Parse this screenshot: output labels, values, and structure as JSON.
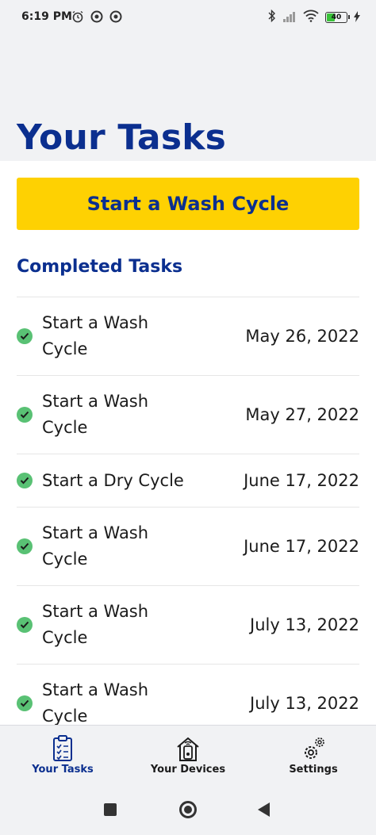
{
  "status_bar": {
    "time": "6:19 PM",
    "battery": "40"
  },
  "header": {
    "title": "Your Tasks"
  },
  "primary_action": {
    "label": "Start a Wash Cycle"
  },
  "completed": {
    "heading": "Completed Tasks",
    "tasks": [
      {
        "name": "Start a Wash Cycle",
        "date": "May 26, 2022"
      },
      {
        "name": "Start a Wash Cycle",
        "date": "May 27, 2022"
      },
      {
        "name": "Start a Dry Cycle",
        "date": "June 17, 2022"
      },
      {
        "name": "Start a Wash Cycle",
        "date": "June 17, 2022"
      },
      {
        "name": "Start a Wash Cycle",
        "date": "July 13, 2022"
      },
      {
        "name": "Start a Wash Cycle",
        "date": "July 13, 2022"
      }
    ]
  },
  "bottom_nav": {
    "items": [
      {
        "label": "Your Tasks",
        "icon": "tasks-clipboard-icon",
        "active": true
      },
      {
        "label": "Your Devices",
        "icon": "devices-home-icon",
        "active": false
      },
      {
        "label": "Settings",
        "icon": "settings-gear-icon",
        "active": false
      }
    ]
  },
  "colors": {
    "brand_blue": "#0b2f8f",
    "accent_yellow": "#fed102",
    "check_green": "#59c174",
    "surface_gray": "#f1f2f4"
  }
}
